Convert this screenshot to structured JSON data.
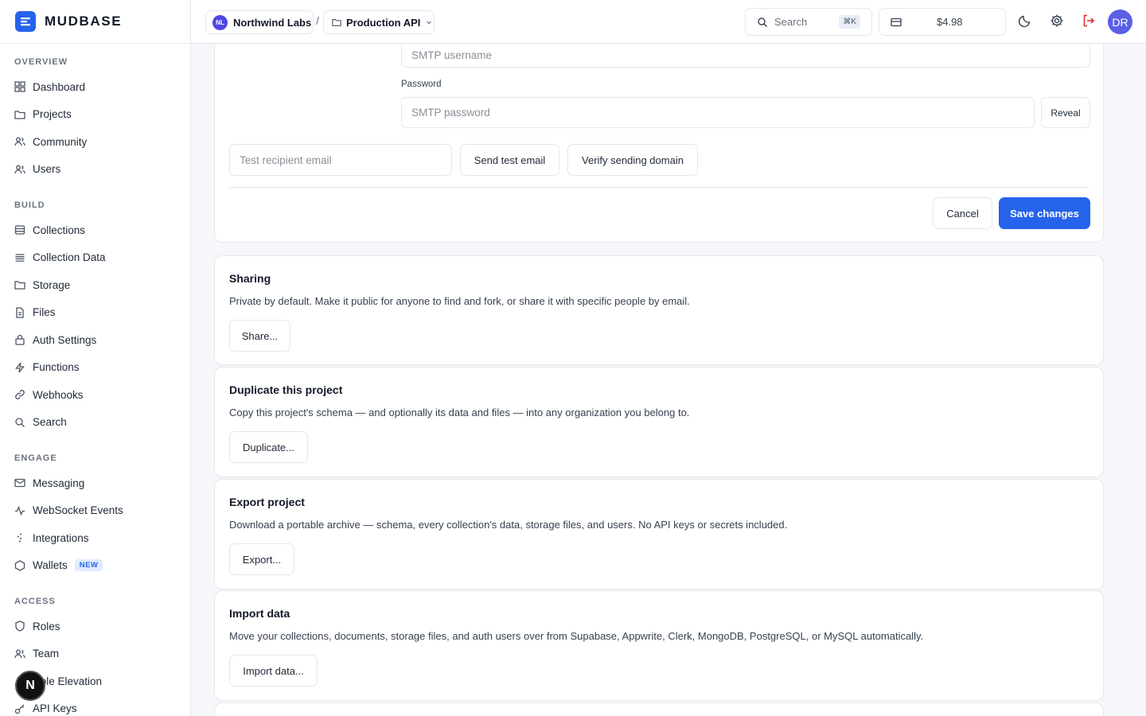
{
  "brand": {
    "name": "MUDBASE"
  },
  "sidebar": {
    "sections": [
      {
        "title": "OVERVIEW",
        "items": [
          {
            "label": "Dashboard",
            "icon": "grid-icon"
          },
          {
            "label": "Projects",
            "icon": "folder-icon"
          },
          {
            "label": "Community",
            "icon": "users-icon"
          },
          {
            "label": "Users",
            "icon": "users-icon"
          }
        ]
      },
      {
        "title": "BUILD",
        "items": [
          {
            "label": "Collections",
            "icon": "database-icon"
          },
          {
            "label": "Collection Data",
            "icon": "list-icon"
          },
          {
            "label": "Storage",
            "icon": "folder-icon"
          },
          {
            "label": "Files",
            "icon": "file-icon"
          },
          {
            "label": "Auth Settings",
            "icon": "lock-icon"
          },
          {
            "label": "Functions",
            "icon": "bolt-icon"
          },
          {
            "label": "Webhooks",
            "icon": "link-icon"
          },
          {
            "label": "Search",
            "icon": "search-icon"
          }
        ]
      },
      {
        "title": "ENGAGE",
        "items": [
          {
            "label": "Messaging",
            "icon": "mail-icon"
          },
          {
            "label": "WebSocket Events",
            "icon": "activity-icon"
          },
          {
            "label": "Integrations",
            "icon": "integrations-icon"
          },
          {
            "label": "Wallets",
            "icon": "hexagon-icon",
            "badge": "NEW"
          }
        ]
      },
      {
        "title": "ACCESS",
        "items": [
          {
            "label": "Roles",
            "icon": "shield-icon"
          },
          {
            "label": "Team",
            "icon": "users-icon"
          },
          {
            "label": "Role Elevation",
            "icon": "user-up-icon"
          },
          {
            "label": "API Keys",
            "icon": "key-icon"
          }
        ]
      }
    ],
    "fab_label": "N"
  },
  "topbar": {
    "org_initials": "NL",
    "org_name": "Northwind Labs",
    "separator": "/",
    "project_name": "Production API",
    "search_label": "Search",
    "search_shortcut": "⌘K",
    "credits": "$4.98",
    "user_initials": "DR"
  },
  "smtp": {
    "username_placeholder": "SMTP username",
    "password_label": "Password",
    "password_placeholder": "SMTP password",
    "reveal_label": "Reveal",
    "test_recipient_placeholder": "Test recipient email",
    "send_test_label": "Send test email",
    "verify_domain_label": "Verify sending domain",
    "cancel_label": "Cancel",
    "save_label": "Save changes"
  },
  "cards": {
    "sharing": {
      "title": "Sharing",
      "description": "Private by default. Make it public for anyone to find and fork, or share it with specific people by email.",
      "button": "Share..."
    },
    "duplicate": {
      "title": "Duplicate this project",
      "description": "Copy this project's schema — and optionally its data and files — into any organization you belong to.",
      "button": "Duplicate..."
    },
    "export": {
      "title": "Export project",
      "description": "Download a portable archive — schema, every collection's data, storage files, and users. No API keys or secrets included.",
      "button": "Export..."
    },
    "import": {
      "title": "Import data",
      "description": "Move your collections, documents, storage files, and auth users over from Supabase, Appwrite, Clerk, MongoDB, PostgreSQL, or MySQL automatically.",
      "button": "Import data..."
    }
  },
  "colors": {
    "accent": "#2563eb",
    "danger": "#dc2626"
  }
}
